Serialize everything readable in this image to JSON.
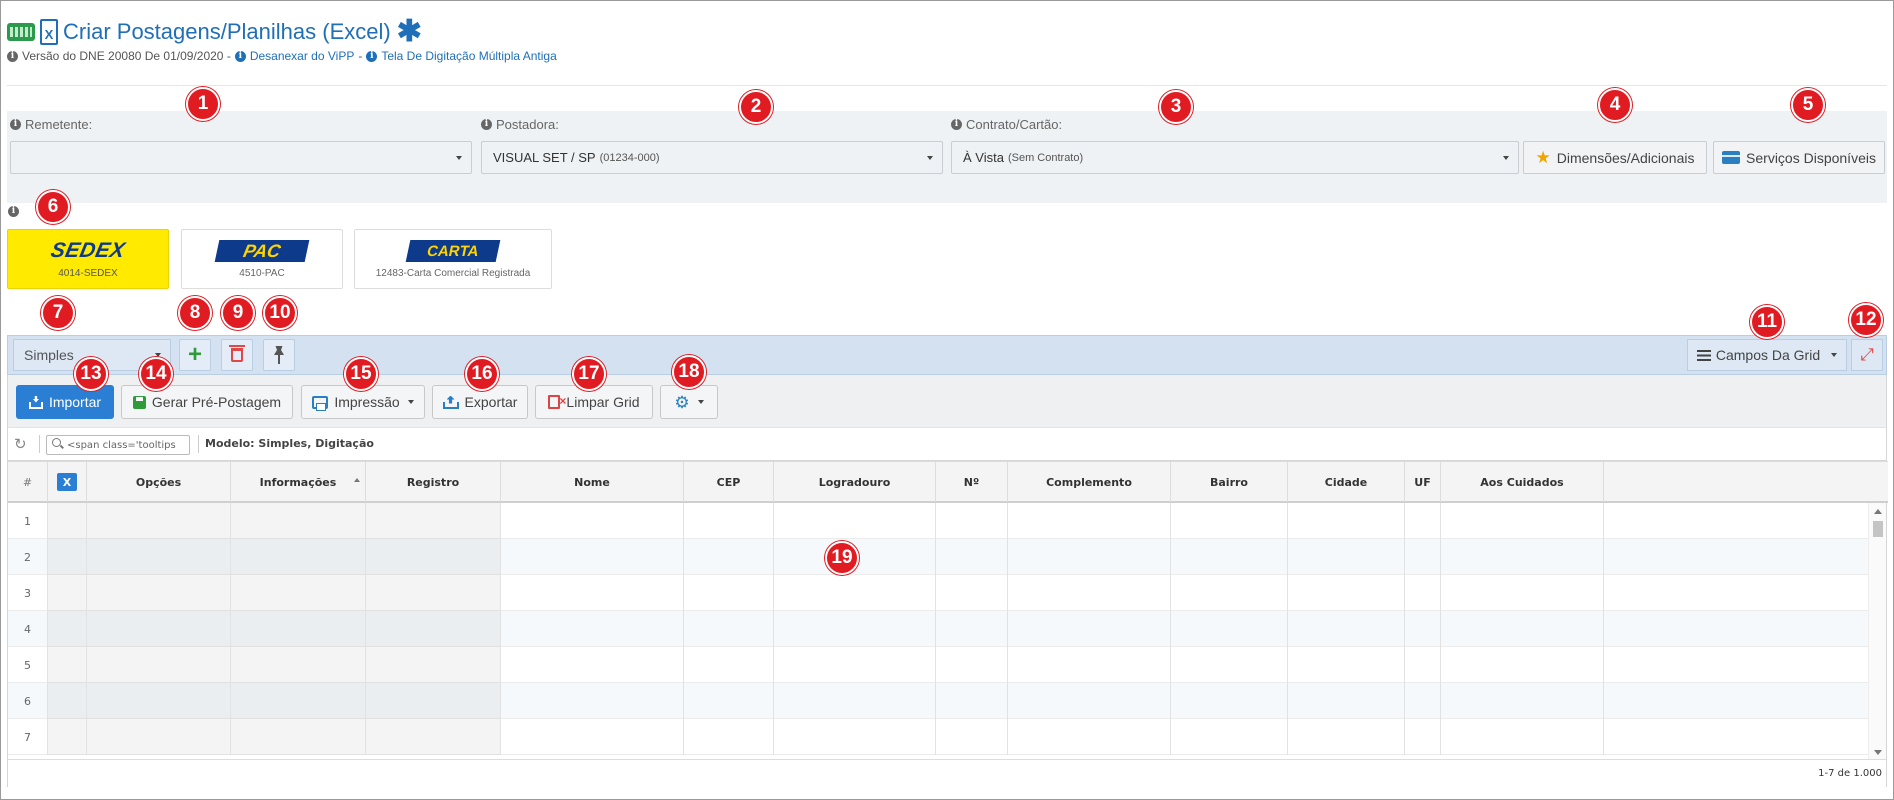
{
  "header": {
    "title": "Criar Postagens/Planilhas (Excel)",
    "version_text": "Versão do DNE 20080 De 01/09/2020 -",
    "unlink_link": "Desanexar do ViPP",
    "old_screen_link": "Tela De Digitação Múltipla Antiga",
    "separator": "-"
  },
  "filters": {
    "sender_label": "Remetente:",
    "sender_value": "",
    "poster_label": "Postadora:",
    "poster_value": "VISUAL SET / SP",
    "poster_code": "(01234-000)",
    "contract_label": "Contrato/Cartão:",
    "contract_value": "À Vista",
    "contract_note": "(Sem Contrato)",
    "dimensions_button": "Dimensões/Adicionais",
    "services_button": "Serviços Disponíveis"
  },
  "services": [
    {
      "logo": "SEDEX",
      "name": "4014-SEDEX",
      "active": true
    },
    {
      "logo": "PAC",
      "name": "4510-PAC",
      "active": false
    },
    {
      "logo": "CARTA",
      "name": "12483-Carta Comercial Registrada",
      "active": false
    }
  ],
  "toolbar": {
    "mode_value": "Simples",
    "grid_fields_button": "Campos Da Grid",
    "import_button": "Importar",
    "generate_button": "Gerar Pré-Postagem",
    "print_button": "Impressão",
    "export_button": "Exportar",
    "clear_button": "Limpar Grid"
  },
  "grid": {
    "search_placeholder": "<span class='tooltips",
    "model_text": "Modelo: Simples, Digitação",
    "row_header": "#",
    "x_badge": "X",
    "columns": [
      "Opções",
      "Informações",
      "Registro",
      "Nome",
      "CEP",
      "Logradouro",
      "Nº",
      "Complemento",
      "Bairro",
      "Cidade",
      "UF",
      "Aos Cuidados"
    ],
    "rows": [
      "1",
      "2",
      "3",
      "4",
      "5",
      "6",
      "7"
    ],
    "pager": "1-7 de 1.000"
  },
  "markers": [
    "1",
    "2",
    "3",
    "4",
    "5",
    "6",
    "7",
    "8",
    "9",
    "10",
    "11",
    "12",
    "13",
    "14",
    "15",
    "16",
    "17",
    "18",
    "19"
  ],
  "colors": {
    "accent": "#1f6fb8",
    "primary_button": "#2a7fd4",
    "marker": "#e01b22",
    "sedex_yellow": "#ffea00"
  }
}
